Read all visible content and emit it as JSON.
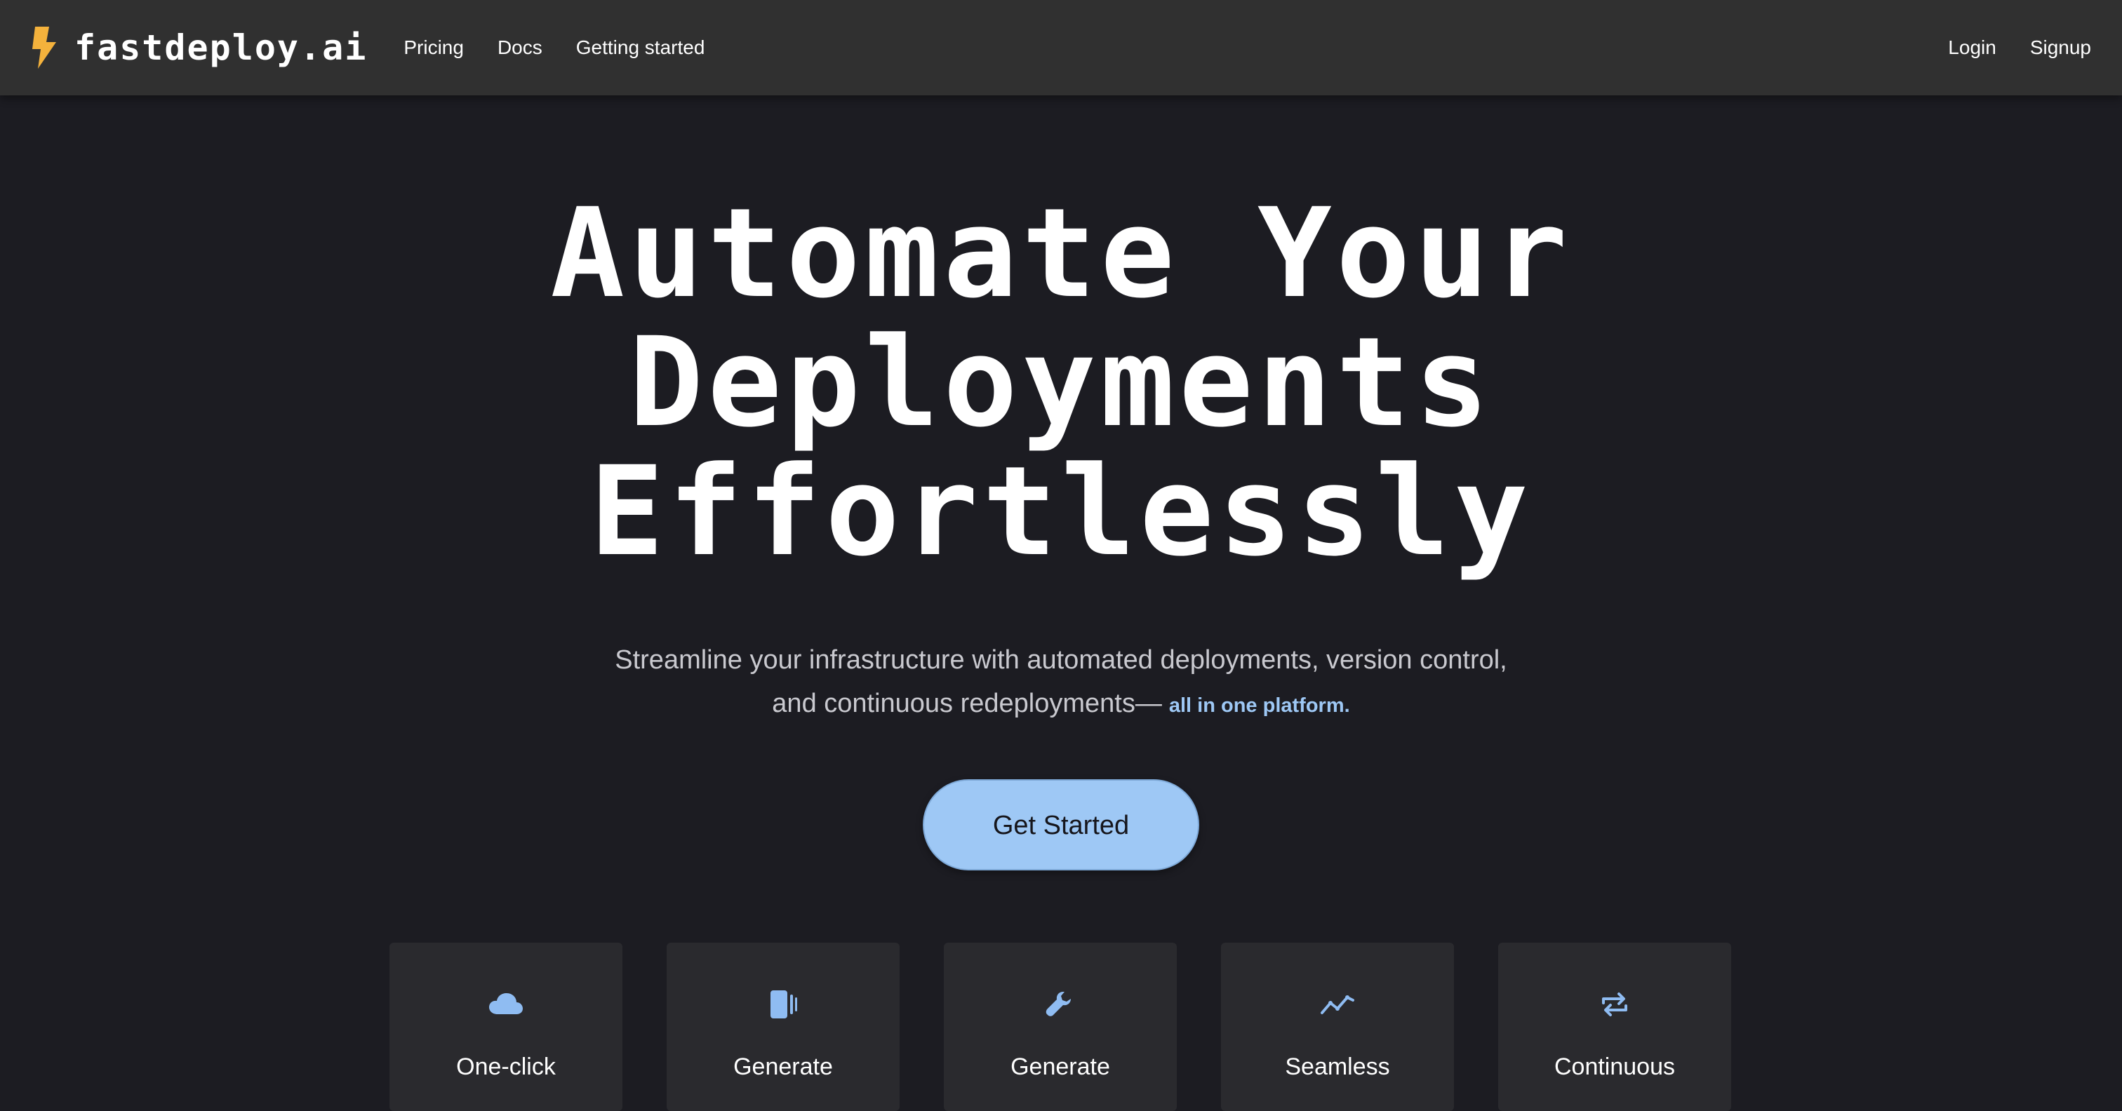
{
  "brand": {
    "name": "fastdeploy.ai",
    "icon": "lightning-bolt-icon",
    "icon_color": "#f4b23c"
  },
  "nav": {
    "links": [
      "Pricing",
      "Docs",
      "Getting started"
    ],
    "login": "Login",
    "signup": "Signup"
  },
  "hero": {
    "headline_lines": [
      "Automate Your",
      "Deployments",
      "Effortlessly"
    ],
    "subhead_line1": "Streamline your infrastructure with automated deployments, version control,",
    "subhead_line2": "and continuous redeployments—",
    "subhead_accent": "all in one platform.",
    "cta_label": "Get Started"
  },
  "features": [
    {
      "icon": "cloud-icon",
      "title": "One-click"
    },
    {
      "icon": "device-icon",
      "title": "Generate"
    },
    {
      "icon": "wrench-icon",
      "title": "Generate"
    },
    {
      "icon": "trend-line-icon",
      "title": "Seamless"
    },
    {
      "icon": "repeat-icon",
      "title": "Continuous"
    }
  ],
  "colors": {
    "background": "#1c1c22",
    "navbar": "#303030",
    "accent": "#9ec8f5",
    "card": "#2a2a2e",
    "icon_blue": "#8fbcf2"
  }
}
